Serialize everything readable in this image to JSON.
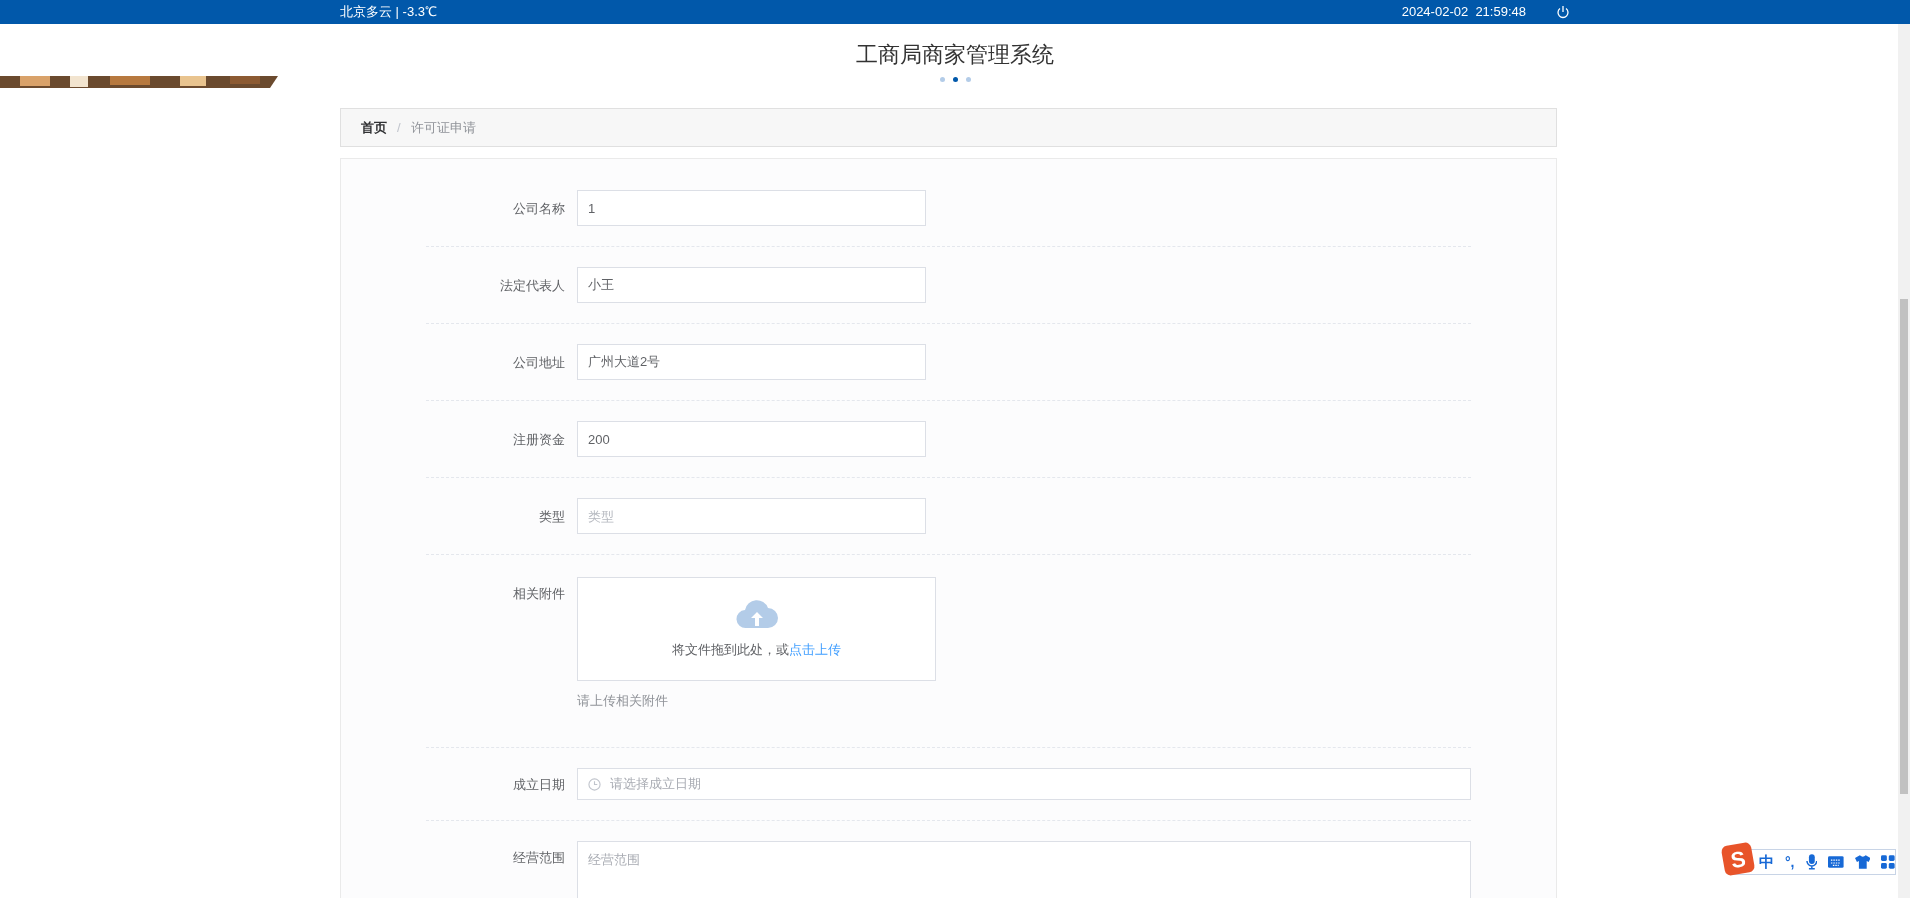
{
  "top_bar": {
    "weather": "北京多云 | -3.3℃",
    "datetime": "2024-02-02  21:59:48"
  },
  "title": "工商局商家管理系统",
  "carousel_dots": [
    {
      "selected": false
    },
    {
      "selected": true
    },
    {
      "selected": false
    }
  ],
  "breadcrumb": [
    {
      "label": "首页",
      "current": false
    },
    {
      "label": "许可证申请",
      "current": true
    }
  ],
  "breadcrumb_separator": "/",
  "form": [
    {
      "kind": "input",
      "label": "公司名称",
      "value": "1"
    },
    {
      "kind": "input",
      "label": "法定代表人",
      "value": "小王"
    },
    {
      "kind": "input",
      "label": "公司地址",
      "value": "广州大道2号"
    },
    {
      "kind": "input",
      "label": "注册资金",
      "value": "200"
    },
    {
      "kind": "input",
      "label": "类型",
      "placeholder": "类型"
    },
    {
      "kind": "upload",
      "label": "相关附件",
      "hint": "将文件拖到此处，或",
      "link": "点击上传",
      "tip": "请上传相关附件"
    },
    {
      "kind": "date",
      "label": "成立日期",
      "placeholder": "请选择成立日期"
    },
    {
      "kind": "textarea",
      "label": "经营范围",
      "placeholder": "经营范围"
    }
  ],
  "ime": {
    "logo": "S",
    "mode": "中",
    "punct": "°,"
  }
}
